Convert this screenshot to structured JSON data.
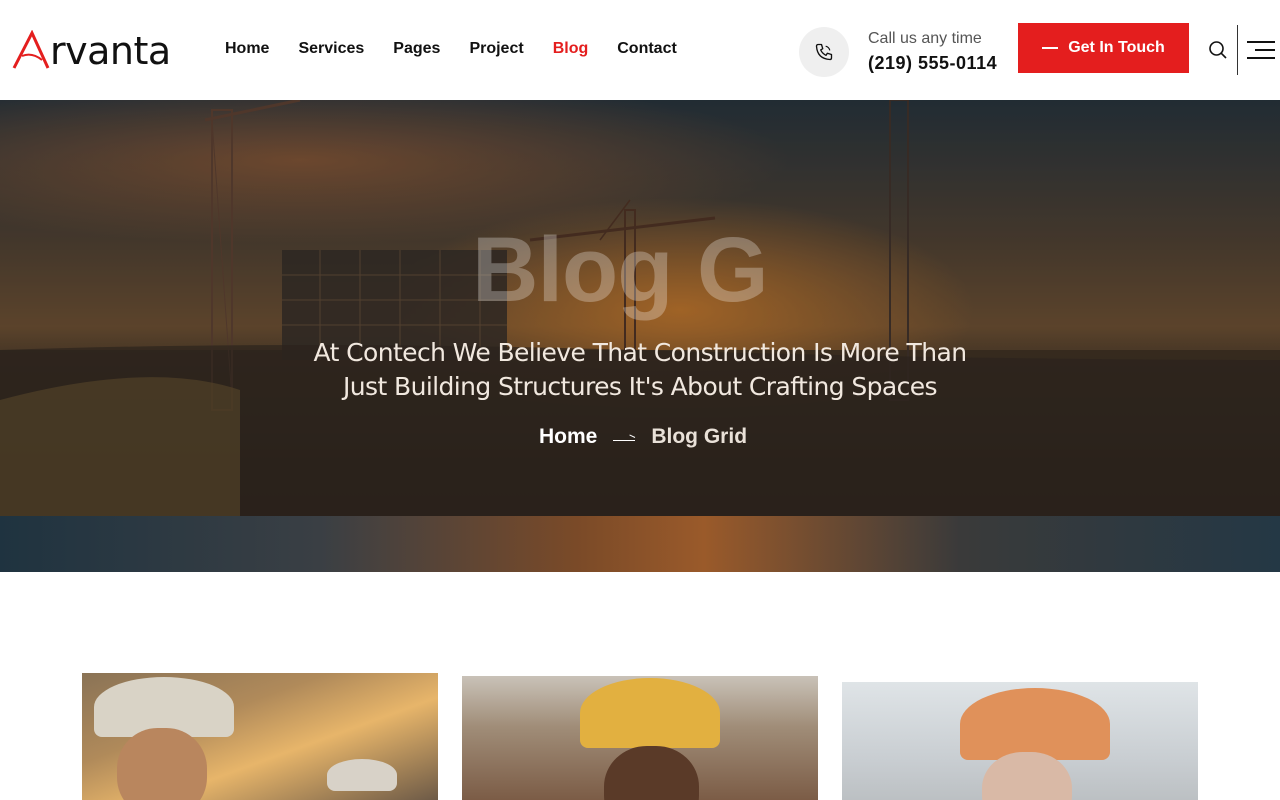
{
  "brand": {
    "logo_letter": "A",
    "logo_rest": "rvanta",
    "accent_color": "#e41e1e"
  },
  "nav": {
    "items": [
      {
        "label": "Home",
        "active": false
      },
      {
        "label": "Services",
        "active": false
      },
      {
        "label": "Pages",
        "active": false
      },
      {
        "label": "Project",
        "active": false
      },
      {
        "label": "Blog",
        "active": true
      },
      {
        "label": "Contact",
        "active": false
      }
    ]
  },
  "contact": {
    "call_label": "Call us any time",
    "phone": "(219) 555-0114",
    "icon": "phone-icon"
  },
  "cta": {
    "label": "Get In Touch"
  },
  "header_icons": {
    "search": "search-icon",
    "menu": "hamburger-menu-icon"
  },
  "hero": {
    "watermark": "Blog G",
    "subtitle": "At Contech We Believe That Construction Is More Than Just Building Structures It's About Crafting Spaces",
    "breadcrumb": {
      "home": "Home",
      "current": "Blog Grid"
    }
  },
  "blog_cards": [
    {
      "image": "construction-workers-photo"
    },
    {
      "image": "worker-yellow-helmet-photo"
    },
    {
      "image": "worker-orange-helmet-photo"
    }
  ]
}
